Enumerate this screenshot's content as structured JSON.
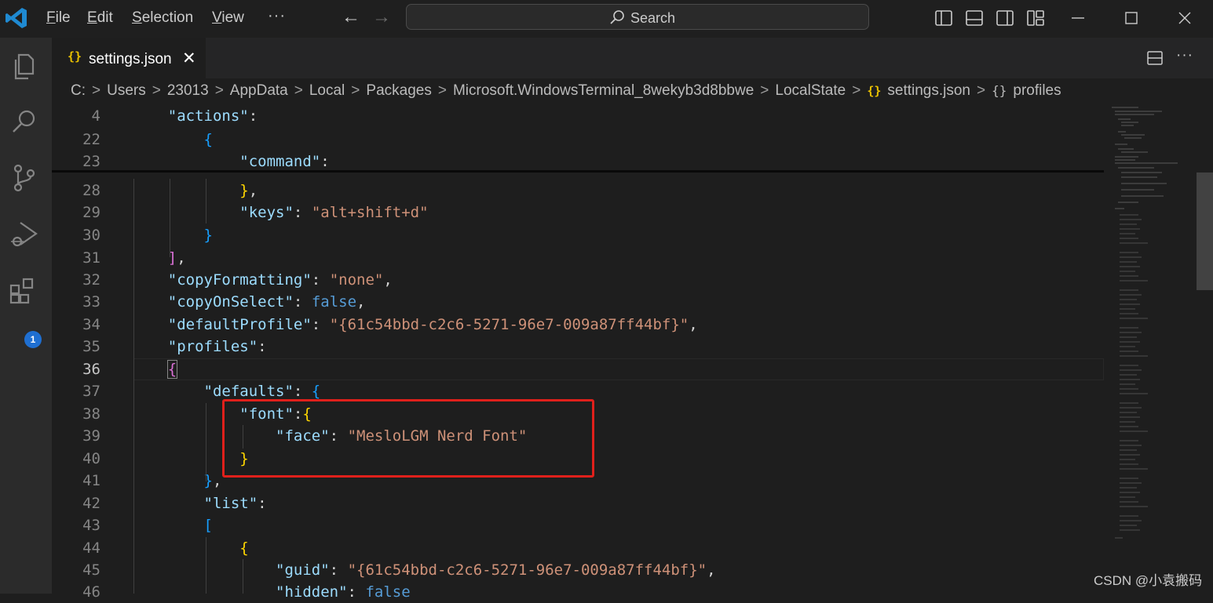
{
  "menu": [
    "File",
    "Edit",
    "Selection",
    "View"
  ],
  "search": {
    "label": "Search"
  },
  "tab": {
    "label": "settings.json",
    "icon": "json-braces-icon"
  },
  "breadcrumb": [
    "C:",
    "Users",
    "23013",
    "AppData",
    "Local",
    "Packages",
    "Microsoft.WindowsTerminal_8wekyb3d8bbwe",
    "LocalState",
    "settings.json",
    "profiles"
  ],
  "extensions_badge": "1",
  "watermark": "CSDN @小袁搬码",
  "colors": {
    "highlight_box": "#e0201b",
    "badge": "#1f6fd1",
    "json_icon": "#e8c000"
  },
  "editor": {
    "active_line": "36",
    "lines": [
      {
        "n": "4"
      },
      {
        "n": "22"
      },
      {
        "n": "23"
      },
      {
        "n": "28"
      },
      {
        "n": "29"
      },
      {
        "n": "30"
      },
      {
        "n": "31"
      },
      {
        "n": "32"
      },
      {
        "n": "33"
      },
      {
        "n": "34"
      },
      {
        "n": "35"
      },
      {
        "n": "36"
      },
      {
        "n": "37"
      },
      {
        "n": "38"
      },
      {
        "n": "39"
      },
      {
        "n": "40"
      },
      {
        "n": "41"
      },
      {
        "n": "42"
      },
      {
        "n": "43"
      },
      {
        "n": "44"
      },
      {
        "n": "45"
      },
      {
        "n": "46"
      }
    ],
    "text": {
      "actions": "\"actions\"",
      "command": "\"command\"",
      "keys": "\"keys\"",
      "keys_val": "\"alt+shift+d\"",
      "copyFormatting": "\"copyFormatting\"",
      "copyFormatting_val": "\"none\"",
      "copyOnSelect": "\"copyOnSelect\"",
      "copyOnSelect_val": "false",
      "defaultProfile": "\"defaultProfile\"",
      "defaultProfile_val": "\"{61c54bbd-c2c6-5271-96e7-009a87ff44bf}\"",
      "profiles": "\"profiles\"",
      "defaults": "\"defaults\"",
      "font": "\"font\"",
      "face": "\"face\"",
      "face_val": "\"MesloLGM Nerd Font\"",
      "list": "\"list\"",
      "guid": "\"guid\"",
      "guid_val": "\"{61c54bbd-c2c6-5271-96e7-009a87ff44bf}\"",
      "hidden": "\"hidden\"",
      "hidden_val": "false"
    }
  }
}
